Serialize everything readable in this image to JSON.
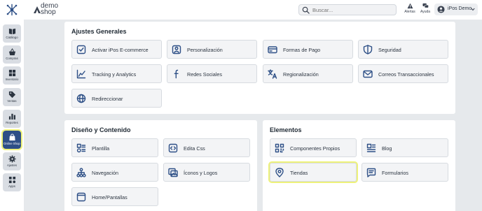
{
  "header": {
    "logo_line1": "demo",
    "logo_line2": "shop",
    "search_placeholder": "Buscar...",
    "alerts_label": "Alertas",
    "help_label": "Ayuda",
    "user_name": "iPos Demo"
  },
  "sidebar": {
    "items": [
      {
        "label": "Catálogo",
        "icon": "book-icon"
      },
      {
        "label": "Compras",
        "icon": "basket-icon"
      },
      {
        "label": "Inventario",
        "icon": "inventory-icon"
      },
      {
        "label": "Ventas",
        "icon": "tag-icon"
      },
      {
        "label": "Reportes",
        "icon": "bar-chart-icon"
      },
      {
        "label": "Online Shop",
        "icon": "shopping-bag-icon",
        "active": true
      },
      {
        "label": "Ajustes",
        "icon": "gear-icon"
      },
      {
        "label": "Apps",
        "icon": "apps-icon"
      }
    ]
  },
  "general": {
    "title": "Ajustes Generales",
    "cards": [
      {
        "label": "Activar iPos E-commerce",
        "icon": "check-square-icon"
      },
      {
        "label": "Personalización",
        "icon": "personalize-icon"
      },
      {
        "label": "Formas de Pago",
        "icon": "credit-card-icon"
      },
      {
        "label": "Seguridad",
        "icon": "shield-icon"
      },
      {
        "label": "Tracking y Analytics",
        "icon": "line-chart-icon"
      },
      {
        "label": "Redes Sociales",
        "icon": "facebook-icon"
      },
      {
        "label": "Regionalización",
        "icon": "translate-icon"
      },
      {
        "label": "Correos Transaccionales",
        "icon": "mail-icon"
      },
      {
        "label": "Redireccionar",
        "icon": "globe-icon"
      }
    ]
  },
  "design": {
    "title": "Diseño y Contenido",
    "cards": [
      {
        "label": "Plantilla",
        "icon": "template-icon"
      },
      {
        "label": "Edita Css",
        "icon": "code-icon"
      },
      {
        "label": "Navegación",
        "icon": "sitemap-icon"
      },
      {
        "label": "Íconos y Logos",
        "icon": "images-icon"
      },
      {
        "label": "Home/Pantallas",
        "icon": "window-icon"
      }
    ]
  },
  "elements": {
    "title": "Elementos",
    "cards": [
      {
        "label": "Componentes Propios",
        "icon": "qr-icon"
      },
      {
        "label": "Blog",
        "icon": "blog-icon"
      },
      {
        "label": "Tiendas",
        "icon": "location-pin-icon",
        "highlighted": true
      },
      {
        "label": "Formularios",
        "icon": "form-icon"
      }
    ]
  },
  "colors": {
    "accent": "#2d4f86",
    "highlight": "#eef27a",
    "background": "#e6e9ec"
  }
}
